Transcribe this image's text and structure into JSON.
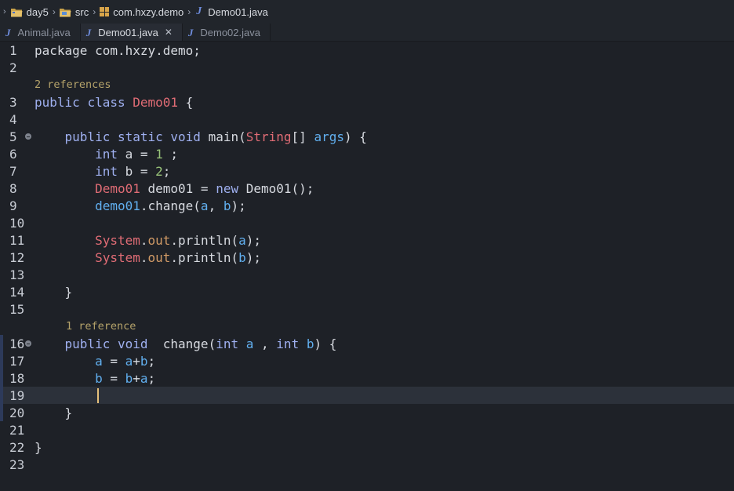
{
  "breadcrumb": {
    "items": [
      "day5",
      "src",
      "com.hxzy.demo",
      "Demo01.java"
    ]
  },
  "tabs": [
    {
      "label": "Animal.java",
      "active": false
    },
    {
      "label": "Demo01.java",
      "active": true,
      "close": "✕"
    },
    {
      "label": "Demo02.java",
      "active": false
    }
  ],
  "editor": {
    "codelens": {
      "class_refs": "2 references",
      "method_refs": "1 reference"
    },
    "line_numbers": [
      "1",
      "2",
      "3",
      "4",
      "5",
      "6",
      "7",
      "8",
      "9",
      "10",
      "11",
      "12",
      "13",
      "14",
      "15",
      "16",
      "17",
      "18",
      "19",
      "20",
      "21",
      "22",
      "23"
    ],
    "current_line": 19,
    "colors": {
      "background": "#1e2127",
      "keyword": "#9fb0f0",
      "type": "#e06c75",
      "number": "#98c379",
      "variable": "#61afef",
      "codelens": "#b5a36a"
    },
    "lines": [
      [
        [
          "plain",
          "package com.hxzy.demo;"
        ]
      ],
      [],
      [
        [
          "kw",
          "public"
        ],
        [
          "plain",
          " "
        ],
        [
          "kw",
          "class"
        ],
        [
          "plain",
          " "
        ],
        [
          "type",
          "Demo01"
        ],
        [
          "plain",
          " {"
        ]
      ],
      [],
      [
        [
          "plain",
          "    "
        ],
        [
          "kw",
          "public"
        ],
        [
          "plain",
          " "
        ],
        [
          "kw",
          "static"
        ],
        [
          "plain",
          " "
        ],
        [
          "kw",
          "void"
        ],
        [
          "plain",
          " main("
        ],
        [
          "type",
          "String"
        ],
        [
          "plain",
          "[] "
        ],
        [
          "var",
          "args"
        ],
        [
          "plain",
          ") {"
        ]
      ],
      [
        [
          "plain",
          "        "
        ],
        [
          "kw",
          "int"
        ],
        [
          "plain",
          " a = "
        ],
        [
          "num",
          "1"
        ],
        [
          "plain",
          " ;"
        ]
      ],
      [
        [
          "plain",
          "        "
        ],
        [
          "kw",
          "int"
        ],
        [
          "plain",
          " b = "
        ],
        [
          "num",
          "2"
        ],
        [
          "plain",
          ";"
        ]
      ],
      [
        [
          "plain",
          "        "
        ],
        [
          "type",
          "Demo01"
        ],
        [
          "plain",
          " demo01 = "
        ],
        [
          "kw",
          "new"
        ],
        [
          "plain",
          " Demo01();"
        ]
      ],
      [
        [
          "plain",
          "        "
        ],
        [
          "var",
          "demo01"
        ],
        [
          "plain",
          ".change("
        ],
        [
          "var",
          "a"
        ],
        [
          "plain",
          ", "
        ],
        [
          "var",
          "b"
        ],
        [
          "plain",
          ");"
        ]
      ],
      [],
      [
        [
          "plain",
          "        "
        ],
        [
          "type",
          "System"
        ],
        [
          "plain",
          "."
        ],
        [
          "fld",
          "out"
        ],
        [
          "plain",
          ".println("
        ],
        [
          "var",
          "a"
        ],
        [
          "plain",
          ");"
        ]
      ],
      [
        [
          "plain",
          "        "
        ],
        [
          "type",
          "System"
        ],
        [
          "plain",
          "."
        ],
        [
          "fld",
          "out"
        ],
        [
          "plain",
          ".println("
        ],
        [
          "var",
          "b"
        ],
        [
          "plain",
          ");"
        ]
      ],
      [],
      [
        [
          "plain",
          "    }"
        ]
      ],
      [],
      [
        [
          "plain",
          "    "
        ],
        [
          "kw",
          "public"
        ],
        [
          "plain",
          " "
        ],
        [
          "kw",
          "void"
        ],
        [
          "plain",
          "  change("
        ],
        [
          "kw",
          "int"
        ],
        [
          "plain",
          " "
        ],
        [
          "var",
          "a"
        ],
        [
          "plain",
          " , "
        ],
        [
          "kw",
          "int"
        ],
        [
          "plain",
          " "
        ],
        [
          "var",
          "b"
        ],
        [
          "plain",
          ") {"
        ]
      ],
      [
        [
          "plain",
          "        "
        ],
        [
          "var",
          "a"
        ],
        [
          "plain",
          " = "
        ],
        [
          "var",
          "a"
        ],
        [
          "plain",
          "+"
        ],
        [
          "var",
          "b"
        ],
        [
          "plain",
          ";"
        ]
      ],
      [
        [
          "plain",
          "        "
        ],
        [
          "var",
          "b"
        ],
        [
          "plain",
          " = "
        ],
        [
          "var",
          "b"
        ],
        [
          "plain",
          "+"
        ],
        [
          "var",
          "a"
        ],
        [
          "plain",
          ";"
        ]
      ],
      [
        [
          "plain",
          "        "
        ]
      ],
      [
        [
          "plain",
          "    }"
        ]
      ],
      [],
      [
        [
          "plain",
          "}"
        ]
      ],
      []
    ]
  }
}
